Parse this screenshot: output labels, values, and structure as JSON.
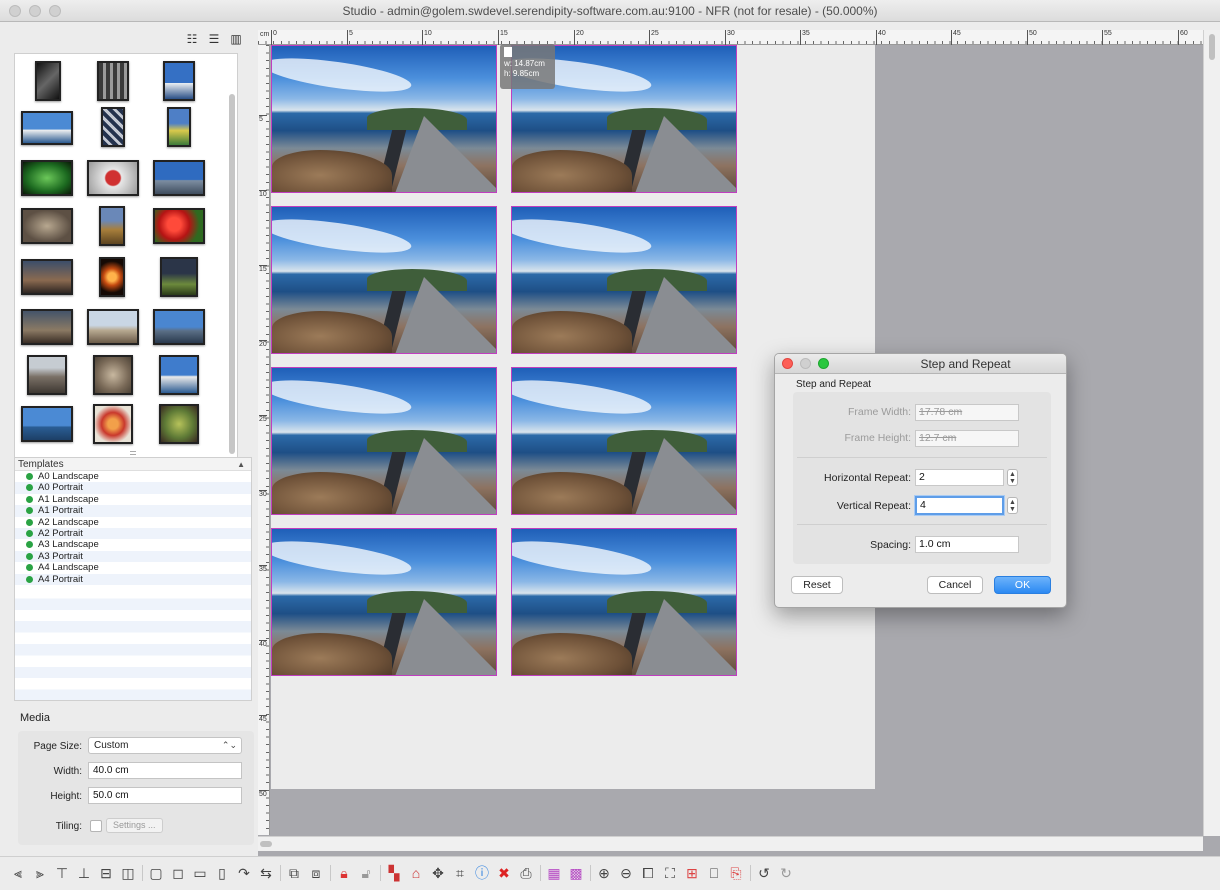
{
  "window": {
    "title": "Studio - admin@golem.swdevel.serendipity-software.com.au:9100 - NFR (not for resale) - (50.000%)"
  },
  "left_panel": {
    "view_modes": [
      "grid-view-icon",
      "list-view-icon",
      "column-view-icon"
    ],
    "templates": {
      "header": "Templates",
      "items": [
        "A0 Landscape",
        "A0 Portrait",
        "A1 Landscape",
        "A1 Portrait",
        "A2 Landscape",
        "A2 Portrait",
        "A3 Landscape",
        "A3 Portrait",
        "A4 Landscape",
        "A4 Portrait"
      ]
    },
    "media": {
      "title": "Media",
      "page_size_label": "Page Size:",
      "page_size_value": "Custom",
      "width_label": "Width:",
      "width_value": "40.0 cm",
      "height_label": "Height:",
      "height_value": "50.0 cm",
      "tiling_label": "Tiling:",
      "settings_label": "Settings ..."
    }
  },
  "ruler": {
    "unit": "cm",
    "top_ticks": [
      "0",
      "5",
      "10",
      "15",
      "20",
      "25",
      "30",
      "35",
      "40",
      "45",
      "50",
      "55",
      "60"
    ],
    "left_ticks": [
      "5",
      "10",
      "15",
      "20",
      "25",
      "30",
      "35",
      "40",
      "45",
      "50"
    ]
  },
  "tooltip": {
    "width": "w: 14.87cm",
    "height": "h: 9.85cm"
  },
  "dialog": {
    "title": "Step and Repeat",
    "heading": "Step and Repeat",
    "frame_width_label": "Frame Width:",
    "frame_width_value": "17.78 cm",
    "frame_height_label": "Frame Height:",
    "frame_height_value": "12.7 cm",
    "horizontal_repeat_label": "Horizontal Repeat:",
    "horizontal_repeat_value": "2",
    "vertical_repeat_label": "Vertical Repeat:",
    "vertical_repeat_value": "4",
    "spacing_label": "Spacing:",
    "spacing_value": "1.0 cm",
    "reset_label": "Reset",
    "cancel_label": "Cancel",
    "ok_label": "OK"
  },
  "colors": {
    "frame_border": "#c03ec0",
    "template_dot": "#2aa344",
    "ok_button": "#2c89f2",
    "canvas_background": "#a9a9ae"
  }
}
